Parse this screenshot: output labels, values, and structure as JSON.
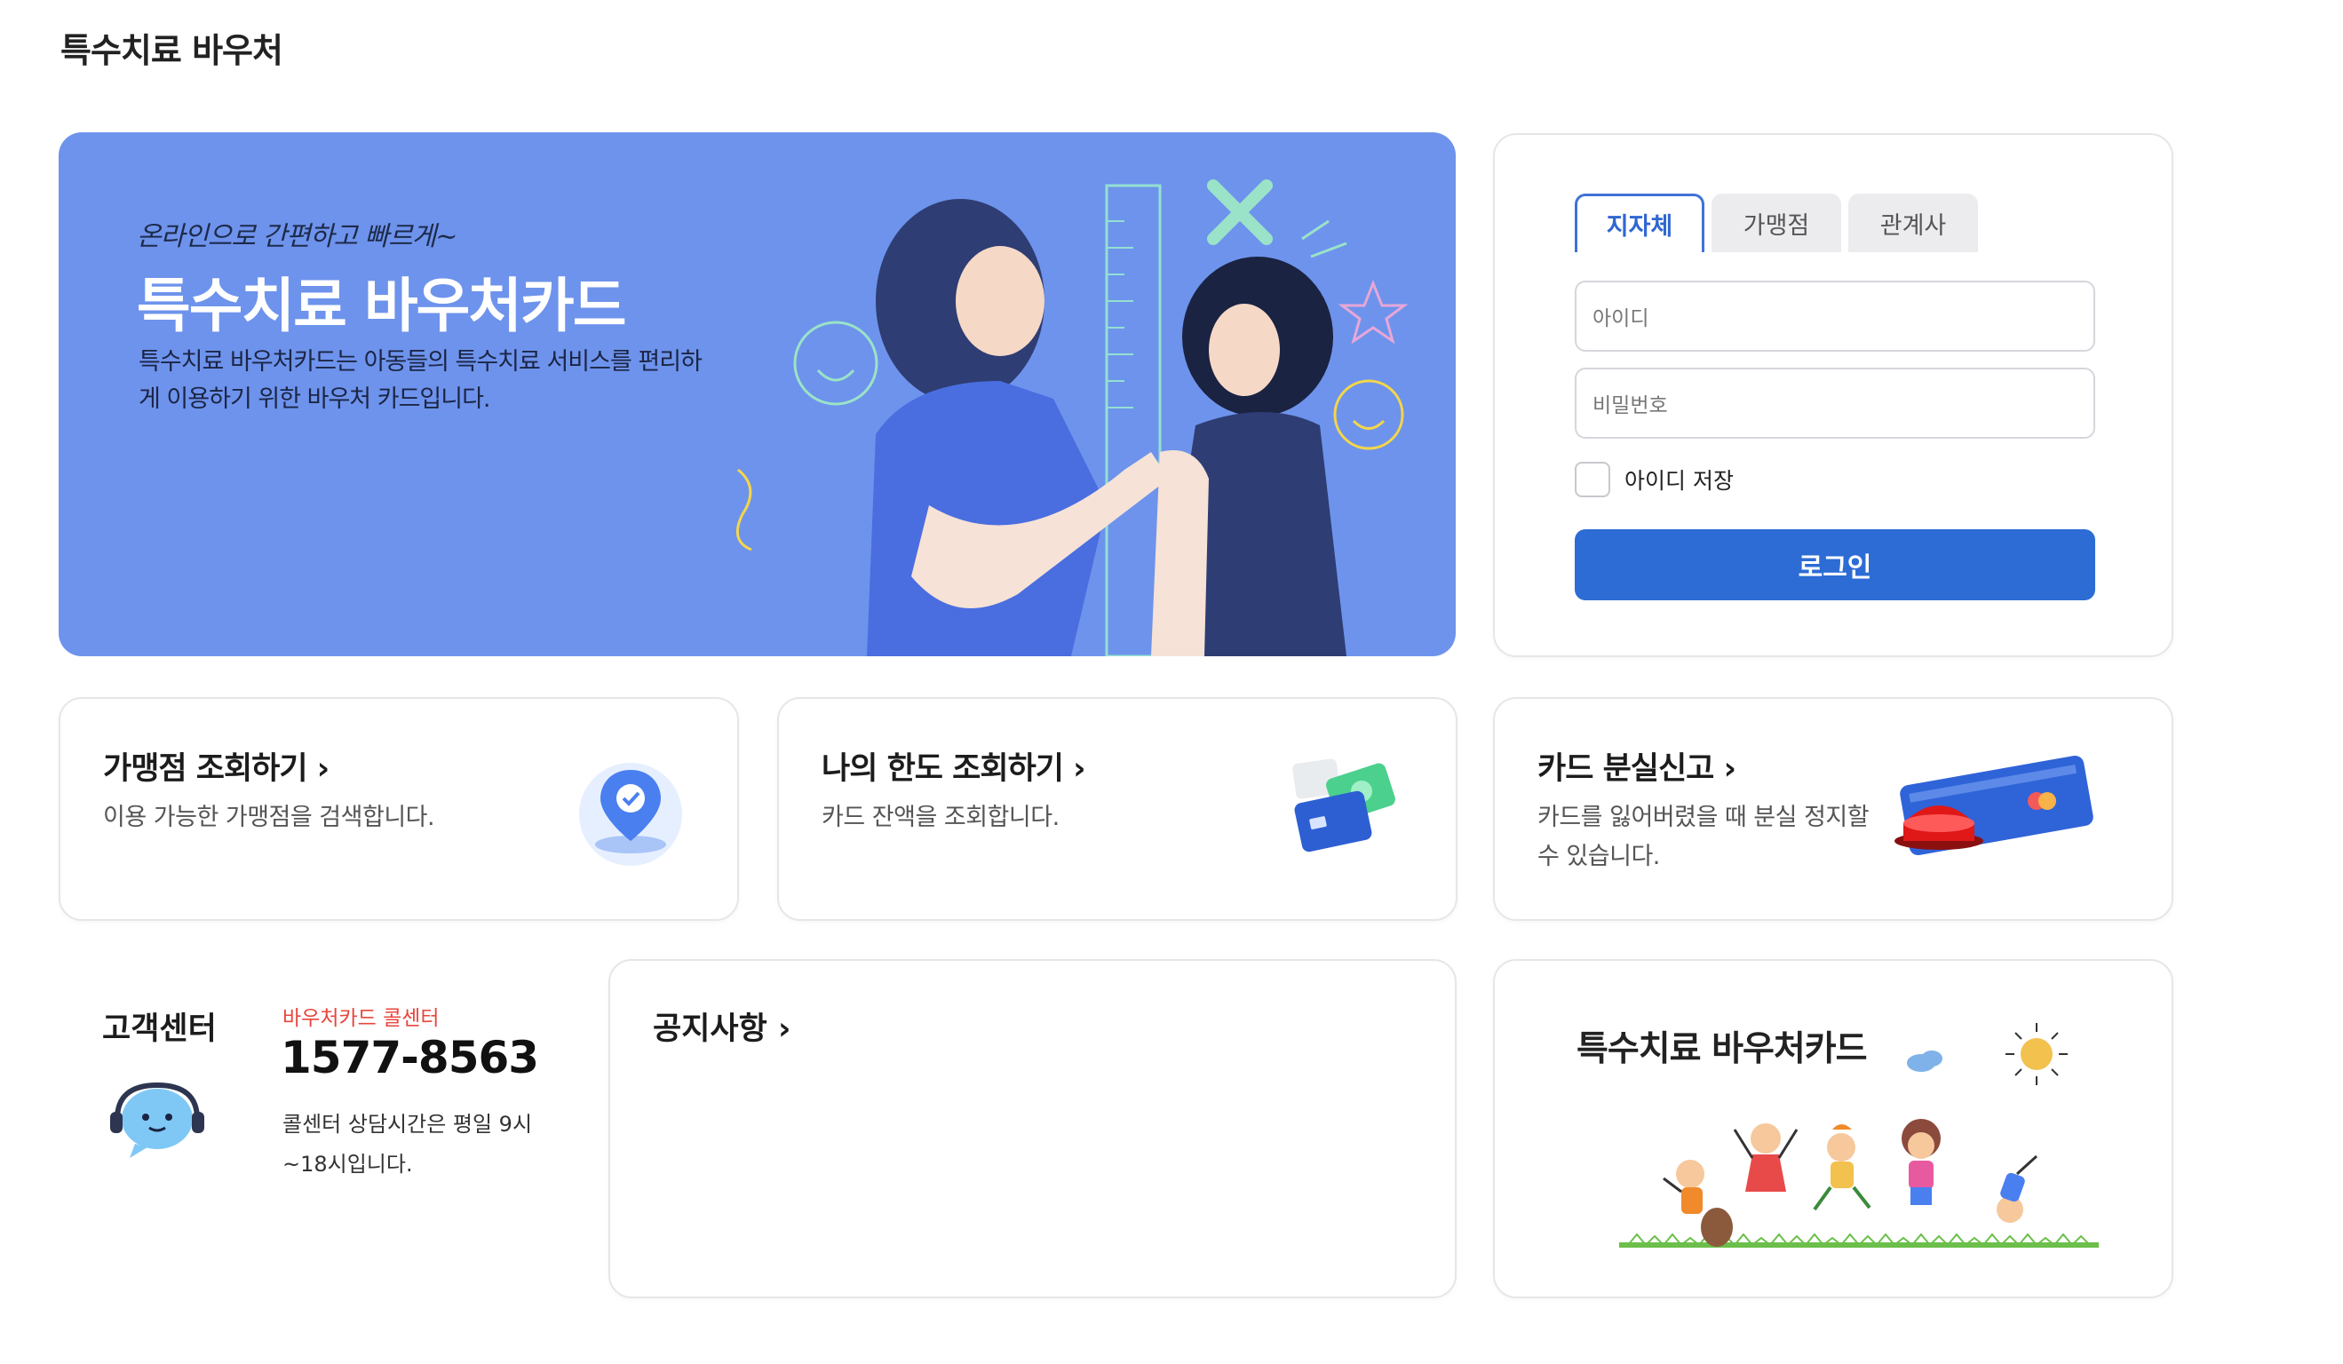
{
  "page": {
    "title": "특수치료 바우처"
  },
  "banner": {
    "tagline": "온라인으로 간편하고 빠르게~",
    "title": "특수치료 바우처카드",
    "description": "특수치료 바우처카드는 아동들의 특수치료 서비스를 편리하게 이용하기 위한 바우처 카드입니다.",
    "accent_color": "#6e93ec"
  },
  "login": {
    "tabs": [
      {
        "label": "지자체",
        "active": true
      },
      {
        "label": "가맹점",
        "active": false
      },
      {
        "label": "관계사",
        "active": false
      }
    ],
    "id_placeholder": "아이디",
    "password_placeholder": "비밀번호",
    "save_id_label": "아이디 저장",
    "save_id_checked": false,
    "submit_label": "로그인",
    "button_color": "#2c6cd4"
  },
  "quick_links": [
    {
      "title": "가맹점 조회하기 ›",
      "description": "이용 가능한 가맹점을 검색합니다.",
      "icon": "map-pin-icon"
    },
    {
      "title": "나의 한도 조회하기 ›",
      "description": "카드 잔액을 조회합니다.",
      "icon": "card-money-icon"
    },
    {
      "title": "카드 분실신고 ›",
      "description": "카드를 잃어버렸을 때 분실 정지할 수 있습니다.",
      "icon": "card-alarm-icon"
    }
  ],
  "customer_center": {
    "title": "고객센터",
    "subtitle": "바우처카드 콜센터",
    "phone": "1577-8563",
    "hours": "콜센터 상담시간은 평일 9시~18시입니다.",
    "icon": "headset-chat-icon"
  },
  "notice": {
    "title": "공지사항 ›"
  },
  "promo": {
    "title": "특수치료 바우처카드",
    "icon": "kids-jumping-illustration"
  }
}
